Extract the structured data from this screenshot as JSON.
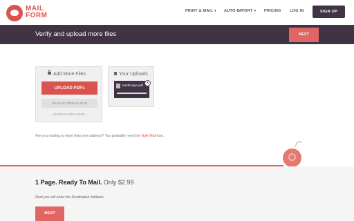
{
  "header": {
    "brand_line1": "MAIL",
    "brand_line2": "FORM",
    "nav": [
      {
        "label": "PRINT & MAIL",
        "has_caret": true
      },
      {
        "label": "AUTO-IMPORT",
        "has_caret": true
      },
      {
        "label": "PRICING",
        "has_caret": false
      },
      {
        "label": "LOG IN",
        "has_caret": false
      }
    ],
    "signup_label": "SIGN UP",
    "caret": "▾"
  },
  "banner": {
    "title": "Verify and upload more files",
    "next_label": "NEXT"
  },
  "add_panel": {
    "title": "Add More Files",
    "upload_label": "UPLOAD PDFs",
    "cloud_label": "UPLOAD FROM CLOUD",
    "drag_text": "→ OR DRAG PDFs HERE ←"
  },
  "uploads_panel": {
    "title": "Your Uploads",
    "file_name": "landscape.pdf",
    "close": "×"
  },
  "bulk": {
    "text_before": "Are you mailing to more than one address? You probably need the ",
    "link": "Bulk Mail",
    "text_after": " tool."
  },
  "summary": {
    "strong": "1 Page. Ready To Mail.",
    "price": " Only $2.99",
    "hint": "Next you will enter the Destination Address",
    "next_label": "NEXT"
  },
  "colors": {
    "accent": "#e06666",
    "dark": "#3f3344"
  }
}
